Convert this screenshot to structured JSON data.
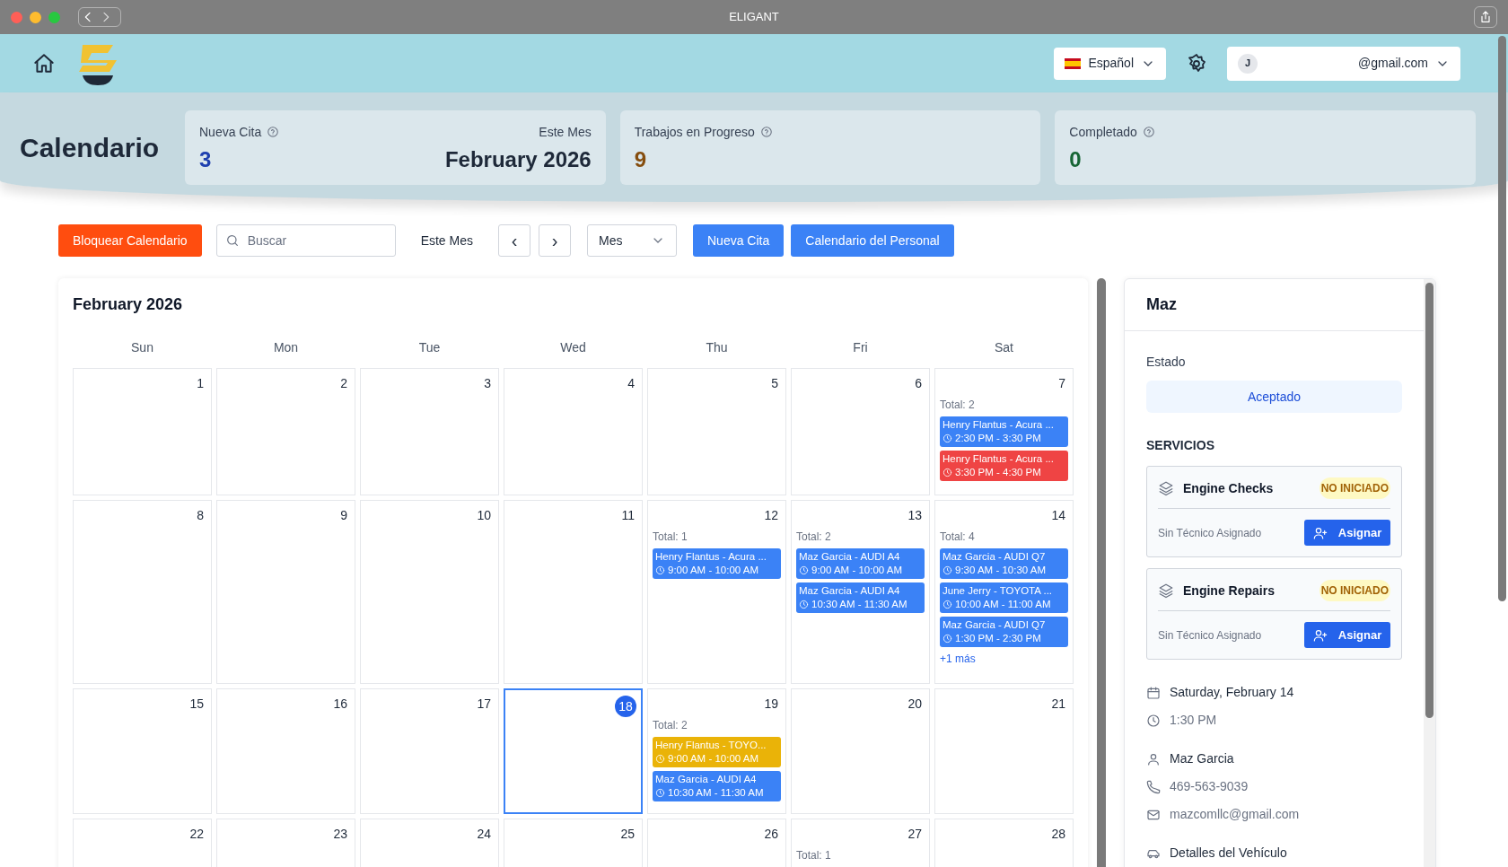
{
  "window": {
    "title": "ELIGANT"
  },
  "header": {
    "language": "Español",
    "user": {
      "initial": "J",
      "email": "@gmail.com"
    }
  },
  "page_title": "Calendario",
  "stats": [
    {
      "label": "Nueva Cita",
      "value": "3",
      "color": "#1e40af",
      "side_label": "Este Mes",
      "side_value": "February 2026"
    },
    {
      "label": "Trabajos en Progreso",
      "value": "9",
      "color": "#854d0e"
    },
    {
      "label": "Completado",
      "value": "0",
      "color": "#166534"
    }
  ],
  "toolbar": {
    "block_button": "Bloquear Calendario",
    "search_placeholder": "Buscar",
    "period_label": "Este Mes",
    "prev": "‹",
    "next": "›",
    "view": "Mes",
    "new_button": "Nueva Cita",
    "staff_button": "Calendario del Personal"
  },
  "calendar": {
    "title": "February 2026",
    "weekdays": [
      "Sun",
      "Mon",
      "Tue",
      "Wed",
      "Thu",
      "Fri",
      "Sat"
    ],
    "weeks": [
      [
        {
          "day": "1",
          "selected": false
        },
        {
          "day": "2",
          "selected": false
        },
        {
          "day": "3",
          "selected": false
        },
        {
          "day": "4",
          "selected": false
        },
        {
          "day": "5",
          "selected": false
        },
        {
          "day": "6",
          "selected": false
        },
        {
          "day": "7",
          "selected": false,
          "total": "Total: 2",
          "events": [
            {
              "title": "Henry Flantus - Acura ...",
              "time": "2:30 PM - 3:30 PM",
              "color": "#3b82f6"
            },
            {
              "title": "Henry Flantus - Acura ...",
              "time": "3:30 PM - 4:30 PM",
              "color": "#ef4444"
            }
          ]
        }
      ],
      [
        {
          "day": "8",
          "selected": false
        },
        {
          "day": "9",
          "selected": false
        },
        {
          "day": "10",
          "selected": false
        },
        {
          "day": "11",
          "selected": false
        },
        {
          "day": "12",
          "selected": false,
          "total": "Total: 1",
          "events": [
            {
              "title": "Henry Flantus - Acura ...",
              "time": "9:00 AM - 10:00 AM",
              "color": "#3b82f6"
            }
          ]
        },
        {
          "day": "13",
          "selected": false,
          "total": "Total: 2",
          "events": [
            {
              "title": "Maz Garcia - AUDI A4",
              "time": "9:00 AM - 10:00 AM",
              "color": "#3b82f6"
            },
            {
              "title": "Maz Garcia - AUDI A4",
              "time": "10:30 AM - 11:30 AM",
              "color": "#3b82f6"
            }
          ]
        },
        {
          "day": "14",
          "selected": false,
          "total": "Total: 4",
          "events": [
            {
              "title": "Maz Garcia - AUDI Q7",
              "time": "9:30 AM - 10:30 AM",
              "color": "#3b82f6"
            },
            {
              "title": "June Jerry - TOYOTA ...",
              "time": "10:00 AM - 11:00 AM",
              "color": "#3b82f6"
            },
            {
              "title": "Maz Garcia - AUDI Q7",
              "time": "1:30 PM - 2:30 PM",
              "color": "#3b82f6"
            }
          ],
          "more": "+1 más"
        }
      ],
      [
        {
          "day": "15",
          "selected": false
        },
        {
          "day": "16",
          "selected": false
        },
        {
          "day": "17",
          "selected": false
        },
        {
          "day": "18",
          "selected": true
        },
        {
          "day": "19",
          "selected": false,
          "total": "Total: 2",
          "events": [
            {
              "title": "Henry Flantus - TOYO...",
              "time": "9:00 AM - 10:00 AM",
              "color": "#eab308"
            },
            {
              "title": "Maz Garcia - AUDI A4",
              "time": "10:30 AM - 11:30 AM",
              "color": "#3b82f6"
            }
          ]
        },
        {
          "day": "20",
          "selected": false
        },
        {
          "day": "21",
          "selected": false
        }
      ],
      [
        {
          "day": "22",
          "selected": false
        },
        {
          "day": "23",
          "selected": false
        },
        {
          "day": "24",
          "selected": false
        },
        {
          "day": "25",
          "selected": false
        },
        {
          "day": "26",
          "selected": false
        },
        {
          "day": "27",
          "selected": false,
          "total": "Total: 1"
        },
        {
          "day": "28",
          "selected": false
        }
      ]
    ]
  },
  "details": {
    "title": "Maz",
    "status_label": "Estado",
    "status": "Aceptado",
    "services_label": "SERVICIOS",
    "services": [
      {
        "name": "Engine Checks",
        "status": "NO INICIADO",
        "technician": "Sin Técnico Asignado",
        "button": "Asignar"
      },
      {
        "name": "Engine Repairs",
        "status": "NO INICIADO",
        "technician": "Sin Técnico Asignado",
        "button": "Asignar"
      }
    ],
    "info": [
      {
        "kind": "date",
        "text": "Saturday, February 14"
      },
      {
        "kind": "time",
        "text": "1:30 PM"
      },
      {
        "kind": "person",
        "text": "Maz Garcia"
      },
      {
        "kind": "phone",
        "text": "469-563-9039"
      },
      {
        "kind": "email",
        "text": "mazcomllc@gmail.com"
      },
      {
        "kind": "vehicle",
        "text": "Detalles del Vehículo"
      }
    ]
  }
}
